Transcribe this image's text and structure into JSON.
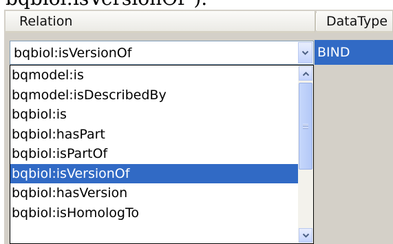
{
  "top_text": "bqbiol:isVersionOf\").",
  "header": {
    "relation_label": "Relation",
    "datatype_label": "DataType"
  },
  "combo": {
    "value": "bqbiol:isVersionOf"
  },
  "datatype_cell": {
    "value": "BIND"
  },
  "dropdown": {
    "items": [
      {
        "label": "bqmodel:is"
      },
      {
        "label": "bqmodel:isDescribedBy"
      },
      {
        "label": "bqbiol:is"
      },
      {
        "label": "bqbiol:hasPart"
      },
      {
        "label": "bqbiol:isPartOf"
      },
      {
        "label": "bqbiol:isVersionOf",
        "selected": true
      },
      {
        "label": "bqbiol:hasVersion"
      },
      {
        "label": "bqbiol:isHomologTo"
      }
    ],
    "scroll_position": 0
  },
  "icons": {
    "combo_dropdown": "chevron-down-icon",
    "scroll_up": "chevron-up-icon",
    "scroll_down": "chevron-down-icon",
    "thumb_grip": "grip-icon"
  },
  "colors": {
    "selection": "#316ac5",
    "grid_background": "#d4d0c8",
    "border": "#7f9db9"
  }
}
